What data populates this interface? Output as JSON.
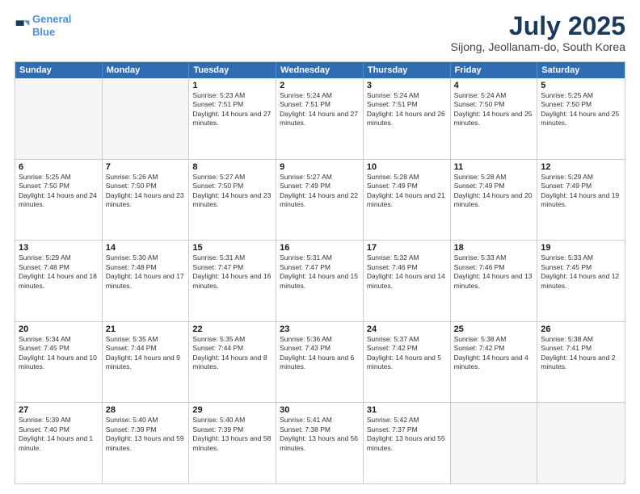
{
  "logo": {
    "line1": "General",
    "line2": "Blue"
  },
  "title": "July 2025",
  "subtitle": "Sijong, Jeollanam-do, South Korea",
  "weekdays": [
    "Sunday",
    "Monday",
    "Tuesday",
    "Wednesday",
    "Thursday",
    "Friday",
    "Saturday"
  ],
  "rows": [
    [
      {
        "day": "",
        "sunrise": "",
        "sunset": "",
        "daylight": ""
      },
      {
        "day": "",
        "sunrise": "",
        "sunset": "",
        "daylight": ""
      },
      {
        "day": "1",
        "sunrise": "Sunrise: 5:23 AM",
        "sunset": "Sunset: 7:51 PM",
        "daylight": "Daylight: 14 hours and 27 minutes."
      },
      {
        "day": "2",
        "sunrise": "Sunrise: 5:24 AM",
        "sunset": "Sunset: 7:51 PM",
        "daylight": "Daylight: 14 hours and 27 minutes."
      },
      {
        "day": "3",
        "sunrise": "Sunrise: 5:24 AM",
        "sunset": "Sunset: 7:51 PM",
        "daylight": "Daylight: 14 hours and 26 minutes."
      },
      {
        "day": "4",
        "sunrise": "Sunrise: 5:24 AM",
        "sunset": "Sunset: 7:50 PM",
        "daylight": "Daylight: 14 hours and 25 minutes."
      },
      {
        "day": "5",
        "sunrise": "Sunrise: 5:25 AM",
        "sunset": "Sunset: 7:50 PM",
        "daylight": "Daylight: 14 hours and 25 minutes."
      }
    ],
    [
      {
        "day": "6",
        "sunrise": "Sunrise: 5:25 AM",
        "sunset": "Sunset: 7:50 PM",
        "daylight": "Daylight: 14 hours and 24 minutes."
      },
      {
        "day": "7",
        "sunrise": "Sunrise: 5:26 AM",
        "sunset": "Sunset: 7:50 PM",
        "daylight": "Daylight: 14 hours and 23 minutes."
      },
      {
        "day": "8",
        "sunrise": "Sunrise: 5:27 AM",
        "sunset": "Sunset: 7:50 PM",
        "daylight": "Daylight: 14 hours and 23 minutes."
      },
      {
        "day": "9",
        "sunrise": "Sunrise: 5:27 AM",
        "sunset": "Sunset: 7:49 PM",
        "daylight": "Daylight: 14 hours and 22 minutes."
      },
      {
        "day": "10",
        "sunrise": "Sunrise: 5:28 AM",
        "sunset": "Sunset: 7:49 PM",
        "daylight": "Daylight: 14 hours and 21 minutes."
      },
      {
        "day": "11",
        "sunrise": "Sunrise: 5:28 AM",
        "sunset": "Sunset: 7:49 PM",
        "daylight": "Daylight: 14 hours and 20 minutes."
      },
      {
        "day": "12",
        "sunrise": "Sunrise: 5:29 AM",
        "sunset": "Sunset: 7:49 PM",
        "daylight": "Daylight: 14 hours and 19 minutes."
      }
    ],
    [
      {
        "day": "13",
        "sunrise": "Sunrise: 5:29 AM",
        "sunset": "Sunset: 7:48 PM",
        "daylight": "Daylight: 14 hours and 18 minutes."
      },
      {
        "day": "14",
        "sunrise": "Sunrise: 5:30 AM",
        "sunset": "Sunset: 7:48 PM",
        "daylight": "Daylight: 14 hours and 17 minutes."
      },
      {
        "day": "15",
        "sunrise": "Sunrise: 5:31 AM",
        "sunset": "Sunset: 7:47 PM",
        "daylight": "Daylight: 14 hours and 16 minutes."
      },
      {
        "day": "16",
        "sunrise": "Sunrise: 5:31 AM",
        "sunset": "Sunset: 7:47 PM",
        "daylight": "Daylight: 14 hours and 15 minutes."
      },
      {
        "day": "17",
        "sunrise": "Sunrise: 5:32 AM",
        "sunset": "Sunset: 7:46 PM",
        "daylight": "Daylight: 14 hours and 14 minutes."
      },
      {
        "day": "18",
        "sunrise": "Sunrise: 5:33 AM",
        "sunset": "Sunset: 7:46 PM",
        "daylight": "Daylight: 14 hours and 13 minutes."
      },
      {
        "day": "19",
        "sunrise": "Sunrise: 5:33 AM",
        "sunset": "Sunset: 7:45 PM",
        "daylight": "Daylight: 14 hours and 12 minutes."
      }
    ],
    [
      {
        "day": "20",
        "sunrise": "Sunrise: 5:34 AM",
        "sunset": "Sunset: 7:45 PM",
        "daylight": "Daylight: 14 hours and 10 minutes."
      },
      {
        "day": "21",
        "sunrise": "Sunrise: 5:35 AM",
        "sunset": "Sunset: 7:44 PM",
        "daylight": "Daylight: 14 hours and 9 minutes."
      },
      {
        "day": "22",
        "sunrise": "Sunrise: 5:35 AM",
        "sunset": "Sunset: 7:44 PM",
        "daylight": "Daylight: 14 hours and 8 minutes."
      },
      {
        "day": "23",
        "sunrise": "Sunrise: 5:36 AM",
        "sunset": "Sunset: 7:43 PM",
        "daylight": "Daylight: 14 hours and 6 minutes."
      },
      {
        "day": "24",
        "sunrise": "Sunrise: 5:37 AM",
        "sunset": "Sunset: 7:42 PM",
        "daylight": "Daylight: 14 hours and 5 minutes."
      },
      {
        "day": "25",
        "sunrise": "Sunrise: 5:38 AM",
        "sunset": "Sunset: 7:42 PM",
        "daylight": "Daylight: 14 hours and 4 minutes."
      },
      {
        "day": "26",
        "sunrise": "Sunrise: 5:38 AM",
        "sunset": "Sunset: 7:41 PM",
        "daylight": "Daylight: 14 hours and 2 minutes."
      }
    ],
    [
      {
        "day": "27",
        "sunrise": "Sunrise: 5:39 AM",
        "sunset": "Sunset: 7:40 PM",
        "daylight": "Daylight: 14 hours and 1 minute."
      },
      {
        "day": "28",
        "sunrise": "Sunrise: 5:40 AM",
        "sunset": "Sunset: 7:39 PM",
        "daylight": "Daylight: 13 hours and 59 minutes."
      },
      {
        "day": "29",
        "sunrise": "Sunrise: 5:40 AM",
        "sunset": "Sunset: 7:39 PM",
        "daylight": "Daylight: 13 hours and 58 minutes."
      },
      {
        "day": "30",
        "sunrise": "Sunrise: 5:41 AM",
        "sunset": "Sunset: 7:38 PM",
        "daylight": "Daylight: 13 hours and 56 minutes."
      },
      {
        "day": "31",
        "sunrise": "Sunrise: 5:42 AM",
        "sunset": "Sunset: 7:37 PM",
        "daylight": "Daylight: 13 hours and 55 minutes."
      },
      {
        "day": "",
        "sunrise": "",
        "sunset": "",
        "daylight": ""
      },
      {
        "day": "",
        "sunrise": "",
        "sunset": "",
        "daylight": ""
      }
    ]
  ]
}
